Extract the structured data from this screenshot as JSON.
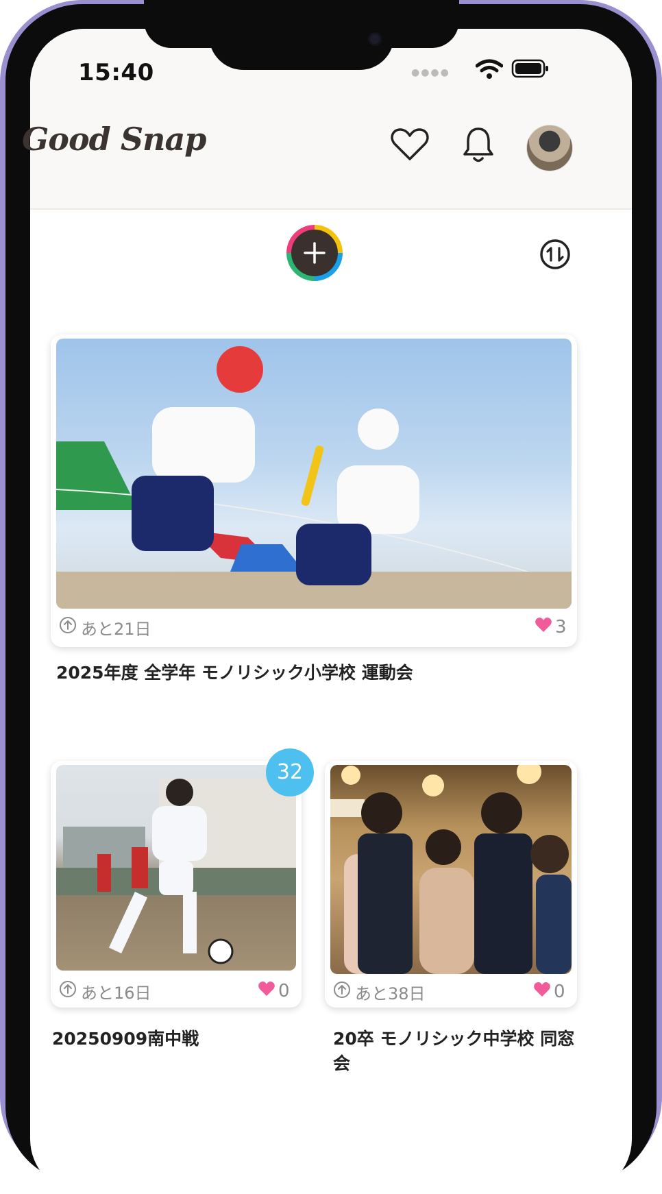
{
  "status_bar": {
    "time": "15:40"
  },
  "header": {
    "logo": "Good Snap",
    "favorites_icon": "heart-outline-icon",
    "notifications_icon": "bell-icon",
    "avatar_alt": "user-avatar"
  },
  "toolbar": {
    "add_icon": "plus-icon",
    "sort_icon": "sort-icon"
  },
  "albums": [
    {
      "title": "2025年度 全学年 モノリシック小学校 運動会",
      "remaining": "あと21日",
      "likes": "3",
      "photo_subject": "relay race"
    },
    {
      "title": "20250909南中戦",
      "remaining": "あと16日",
      "likes": "0",
      "badge": "32",
      "photo_subject": "soccer match"
    },
    {
      "title": "20卒 モノリシック中学校 同窓会",
      "remaining": "あと38日",
      "likes": "0",
      "photo_subject": "reunion party"
    }
  ],
  "colors": {
    "accent_badge": "#4dc0ef",
    "heart": "#f25b9a",
    "frame": "#9b8fd0"
  }
}
